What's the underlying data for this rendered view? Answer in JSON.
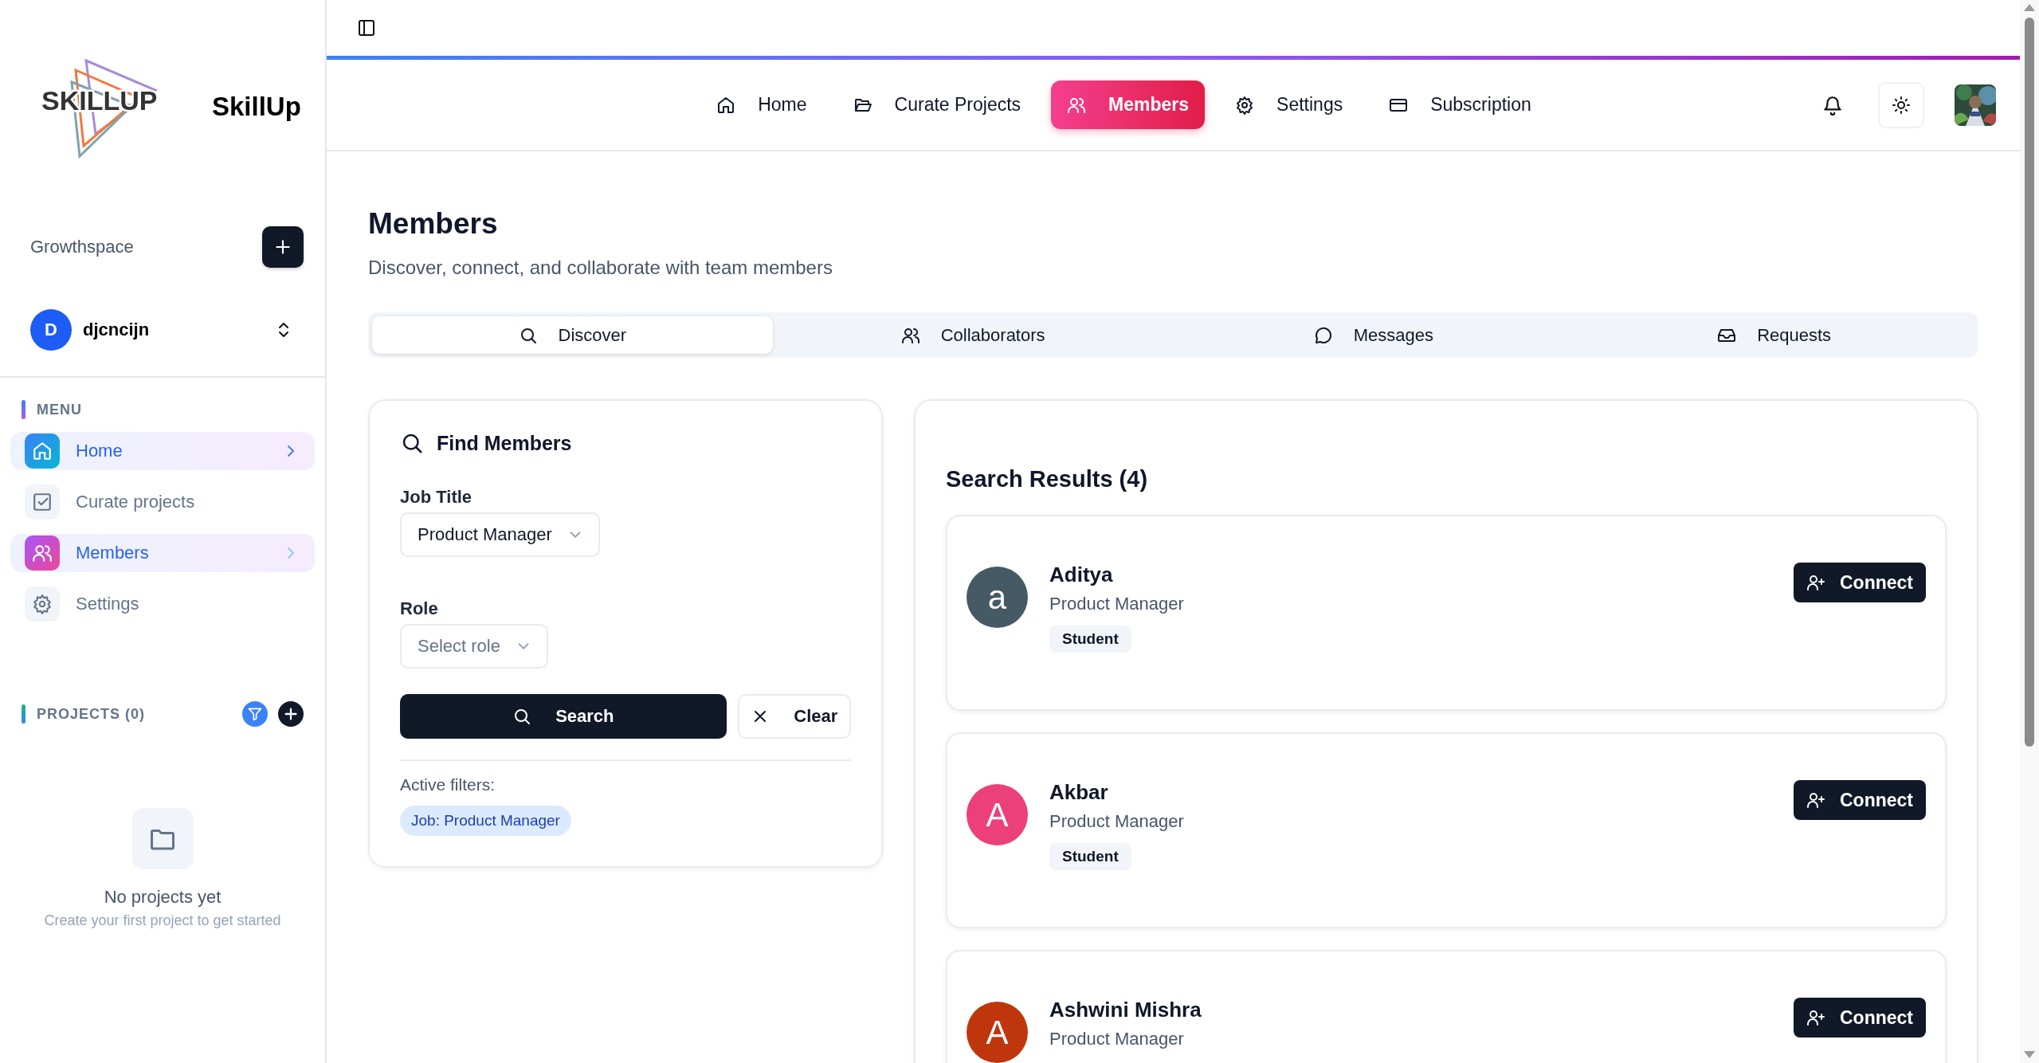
{
  "sidebar": {
    "logo_text": "SKILLUP",
    "brand": "SkillUp",
    "workspace": {
      "label": "Growthspace"
    },
    "user": {
      "initial": "D",
      "name": "djcncijn"
    },
    "menu_heading": "MENU",
    "menu": [
      {
        "label": "Home",
        "selected": true
      },
      {
        "label": "Curate projects",
        "selected": false
      },
      {
        "label": "Members",
        "selected": true
      },
      {
        "label": "Settings",
        "selected": false
      }
    ],
    "projects": {
      "heading": "PROJECTS (0)",
      "empty_title": "No projects yet",
      "empty_text": "Create your first project to get started"
    }
  },
  "header": {
    "nav": [
      {
        "label": "Home",
        "selected": false
      },
      {
        "label": "Curate Projects",
        "selected": false
      },
      {
        "label": "Members",
        "selected": true
      },
      {
        "label": "Settings",
        "selected": false
      },
      {
        "label": "Subscription",
        "selected": false
      }
    ]
  },
  "page": {
    "title": "Members",
    "subtitle": "Discover, connect, and collaborate with team members",
    "tabs": [
      {
        "label": "Discover",
        "selected": true
      },
      {
        "label": "Collaborators",
        "selected": false
      },
      {
        "label": "Messages",
        "selected": false
      },
      {
        "label": "Requests",
        "selected": false
      }
    ],
    "filters": {
      "title": "Find Members",
      "fields": [
        {
          "label": "Job Title",
          "value": "Product Manager"
        },
        {
          "label": "Role",
          "placeholder": "Select role"
        }
      ],
      "search_button": "Search",
      "clear_button": "Clear",
      "active_label": "Active filters:",
      "active_filters": [
        "Job: Product Manager"
      ]
    },
    "results": {
      "title": "Search Results (4)",
      "members": [
        {
          "initial": "a",
          "color": "#455a64",
          "name": "Aditya",
          "job": "Product Manager",
          "badge": "Student",
          "action": "Connect"
        },
        {
          "initial": "A",
          "color": "#ec407a",
          "name": "Akbar",
          "job": "Product Manager",
          "badge": "Student",
          "action": "Connect"
        },
        {
          "initial": "A",
          "color": "#bf360c",
          "name": "Ashwini Mishra",
          "job": "Product Manager",
          "action": "Connect"
        }
      ]
    }
  }
}
